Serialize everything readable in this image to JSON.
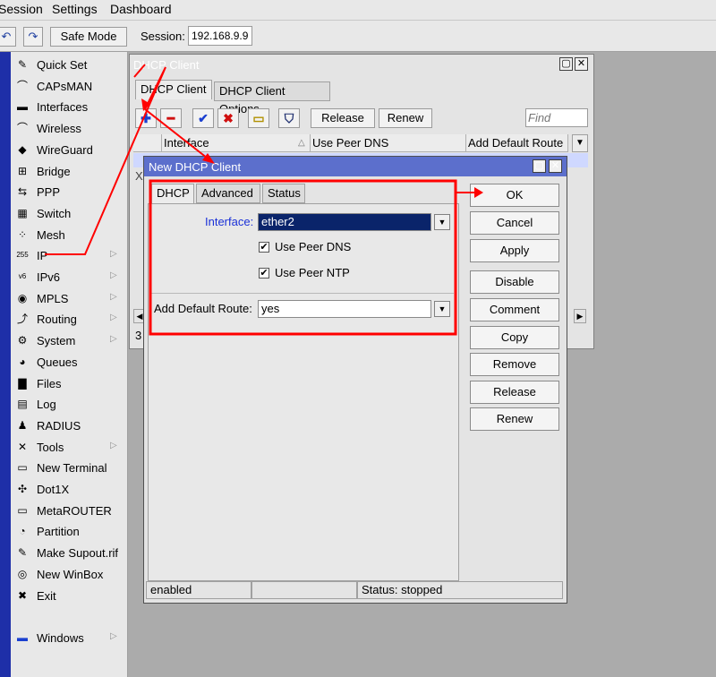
{
  "menubar": {
    "items": [
      "Session",
      "Settings",
      "Dashboard"
    ]
  },
  "toolbar": {
    "undo_icon": "undo-icon",
    "redo_icon": "redo-icon",
    "safe_mode": "Safe Mode",
    "session_label": "Session:",
    "session_value": "192.168.9.9"
  },
  "sidebar": {
    "items": [
      {
        "label": "Quick Set",
        "icon": "✎"
      },
      {
        "label": "CAPsMAN",
        "icon": "⌒"
      },
      {
        "label": "Interfaces",
        "icon": "▬"
      },
      {
        "label": "Wireless",
        "icon": "⌒"
      },
      {
        "label": "WireGuard",
        "icon": "◆"
      },
      {
        "label": "Bridge",
        "icon": "⊞"
      },
      {
        "label": "PPP",
        "icon": "⇆"
      },
      {
        "label": "Switch",
        "icon": "▦"
      },
      {
        "label": "Mesh",
        "icon": "⁘"
      },
      {
        "label": "IP",
        "icon": "255"
      },
      {
        "label": "IPv6",
        "icon": "v6"
      },
      {
        "label": "MPLS",
        "icon": "◉"
      },
      {
        "label": "Routing",
        "icon": "⤴"
      },
      {
        "label": "System",
        "icon": "⚙"
      },
      {
        "label": "Queues",
        "icon": "◕"
      },
      {
        "label": "Files",
        "icon": "▇"
      },
      {
        "label": "Log",
        "icon": "▤"
      },
      {
        "label": "RADIUS",
        "icon": "♟"
      },
      {
        "label": "Tools",
        "icon": "✕"
      },
      {
        "label": "New Terminal",
        "icon": "▭"
      },
      {
        "label": "Dot1X",
        "icon": "✣"
      },
      {
        "label": "MetaROUTER",
        "icon": "▭"
      },
      {
        "label": "Partition",
        "icon": "◔"
      },
      {
        "label": "Make Supout.rif",
        "icon": "✎"
      },
      {
        "label": "New WinBox",
        "icon": "◎"
      },
      {
        "label": "Exit",
        "icon": "✖"
      }
    ],
    "windows": "Windows"
  },
  "dhcp_window": {
    "title": "DHCP Client",
    "tabs": [
      "DHCP Client",
      "DHCP Client Options"
    ],
    "buttons": {
      "release": "Release",
      "renew": "Renew"
    },
    "find_placeholder": "Find",
    "columns": [
      "Interface",
      "Use Peer DNS",
      "Add Default Route"
    ],
    "row_marker": "X",
    "count": "3"
  },
  "new_dialog": {
    "title": "New DHCP Client",
    "tabs": [
      "DHCP",
      "Advanced",
      "Status"
    ],
    "interface_label": "Interface:",
    "interface_value": "ether2",
    "use_peer_dns": "Use Peer DNS",
    "use_peer_ntp": "Use Peer NTP",
    "add_default_route_label": "Add Default Route:",
    "add_default_route_value": "yes",
    "buttons": [
      "OK",
      "Cancel",
      "Apply",
      "Disable",
      "Comment",
      "Copy",
      "Remove",
      "Release",
      "Renew"
    ],
    "status_enabled": "enabled",
    "status_text": "Status: stopped"
  },
  "colors": {
    "annotation": "#ff0000",
    "title_active": "#5c6fcc",
    "selection": "#0a246a"
  }
}
